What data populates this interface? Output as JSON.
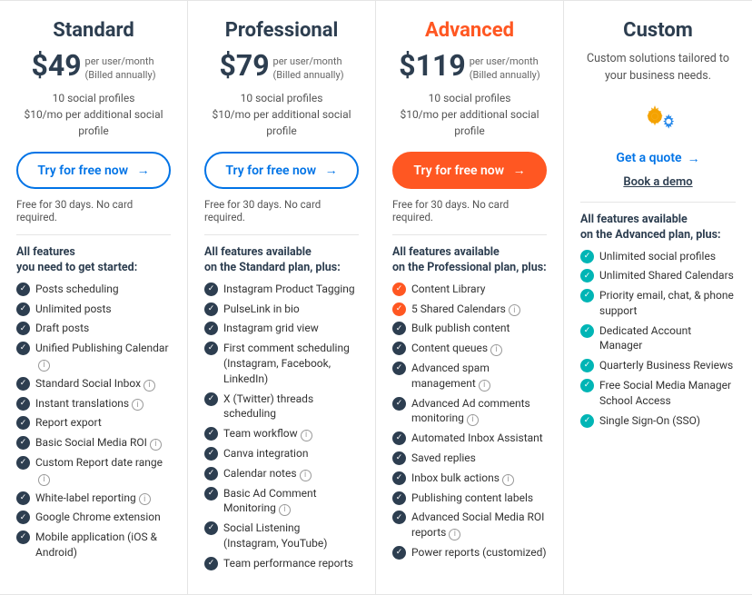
{
  "plans": [
    {
      "id": "standard",
      "title": "Standard",
      "titleClass": "standard",
      "price": "$49",
      "priceDetails": "per user/month\n(Billed annually)",
      "profileInfo": "10 social profiles\n$10/mo per additional social profile",
      "ctaLabel": "Try for free now",
      "ctaStyle": "outline",
      "freeNote": "Free for 30 days. No card required.",
      "featuresHeader": "All features\nyou need to get started:",
      "features": [
        {
          "text": "Posts scheduling",
          "info": false
        },
        {
          "text": "Unlimited posts",
          "info": false
        },
        {
          "text": "Draft posts",
          "info": false
        },
        {
          "text": "Unified Publishing Calendar",
          "info": true
        },
        {
          "text": "Standard Social Inbox",
          "info": true
        },
        {
          "text": "Instant translations",
          "info": true
        },
        {
          "text": "Report export",
          "info": false
        },
        {
          "text": "Basic Social Media ROI",
          "info": true
        },
        {
          "text": "Custom Report date range",
          "info": true
        },
        {
          "text": "White-label reporting",
          "info": true
        },
        {
          "text": "Google Chrome extension",
          "info": false
        },
        {
          "text": "Mobile application (iOS & Android)",
          "info": false
        }
      ]
    },
    {
      "id": "professional",
      "title": "Professional",
      "titleClass": "professional",
      "price": "$79",
      "priceDetails": "per user/month\n(Billed annually)",
      "profileInfo": "10 social profiles\n$10/mo per additional social profile",
      "ctaLabel": "Try for free now",
      "ctaStyle": "outline",
      "freeNote": "Free for 30 days. No card required.",
      "featuresHeader": "All features available\non the Standard plan, plus:",
      "features": [
        {
          "text": "Instagram Product Tagging",
          "info": false
        },
        {
          "text": "PulseLink in bio",
          "info": false
        },
        {
          "text": "Instagram grid view",
          "info": false
        },
        {
          "text": "First comment scheduling\n(Instagram, Facebook, LinkedIn)",
          "info": false
        },
        {
          "text": "X (Twitter) threads scheduling",
          "info": false
        },
        {
          "text": "Team workflow",
          "info": true
        },
        {
          "text": "Canva integration",
          "info": false
        },
        {
          "text": "Calendar notes",
          "info": true
        },
        {
          "text": "Basic Ad Comment Monitoring",
          "info": true
        },
        {
          "text": "Social Listening\n(Instagram, YouTube)",
          "info": false
        },
        {
          "text": "Team performance reports",
          "info": false
        }
      ]
    },
    {
      "id": "advanced",
      "title": "Advanced",
      "titleClass": "advanced",
      "price": "$119",
      "priceDetails": "per user/month\n(Billed annually)",
      "profileInfo": "10 social profiles\n$10/mo per additional social profile",
      "ctaLabel": "Try for free now",
      "ctaStyle": "filled",
      "freeNote": "Free for 30 days. No card required.",
      "featuresHeader": "All features available\non the Professional plan, plus:",
      "features": [
        {
          "text": "Content Library",
          "info": false,
          "orange": true
        },
        {
          "text": "5 Shared Calendars",
          "info": true,
          "orange": true
        },
        {
          "text": "Bulk publish content",
          "info": false
        },
        {
          "text": "Content queues",
          "info": true
        },
        {
          "text": "Advanced spam management",
          "info": true
        },
        {
          "text": "Advanced Ad comments monitoring",
          "info": true
        },
        {
          "text": "Automated Inbox Assistant",
          "info": false
        },
        {
          "text": "Saved replies",
          "info": false
        },
        {
          "text": "Inbox bulk actions",
          "info": true
        },
        {
          "text": "Publishing content labels",
          "info": false
        },
        {
          "text": "Advanced Social Media ROI reports",
          "info": true
        },
        {
          "text": "Power reports (customized)",
          "info": false
        }
      ]
    },
    {
      "id": "custom",
      "title": "Custom",
      "titleClass": "custom",
      "customDesc": "Custom solutions tailored to your business needs.",
      "ctaLabel": "Get a quote",
      "bookDemoLabel": "Book a demo",
      "featuresHeader": "All features available\non the Advanced plan, plus:",
      "features": [
        {
          "text": "Unlimited social profiles",
          "info": false
        },
        {
          "text": "Unlimited Shared Calendars",
          "info": false
        },
        {
          "text": "Priority email, chat, & phone support",
          "info": false
        },
        {
          "text": "Dedicated Account Manager",
          "info": false
        },
        {
          "text": "Quarterly Business Reviews",
          "info": false
        },
        {
          "text": "Free Social Media Manager School Access",
          "info": false
        },
        {
          "text": "Single Sign-On (SSO)",
          "info": false
        }
      ]
    }
  ],
  "icons": {
    "check": "✓",
    "info": "i",
    "arrow": "→"
  }
}
